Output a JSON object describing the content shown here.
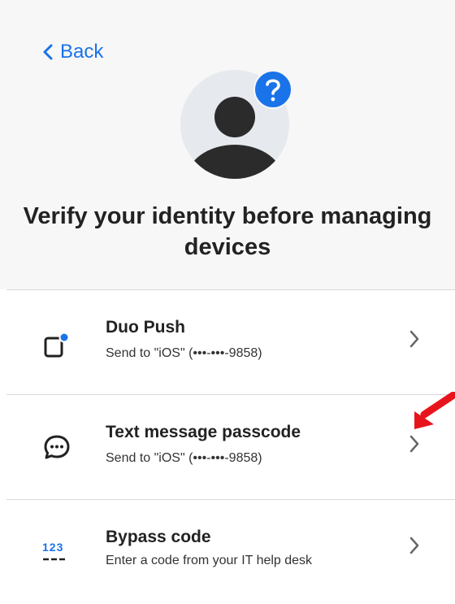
{
  "header": {
    "back_label": "Back",
    "title": "Verify your identity before managing devices"
  },
  "options": [
    {
      "name": "Duo Push",
      "description": "Send to \"iOS\" (•••-•••-9858)",
      "icon": "phone-push-icon"
    },
    {
      "name": "Text message passcode",
      "description": "Send to \"iOS\" (•••-•••-9858)",
      "icon": "chat-bubble-icon"
    },
    {
      "name": "Bypass code",
      "description": "Enter a code from your IT help desk",
      "icon": "bypass-123-icon"
    }
  ],
  "icons": {
    "bypass_digits": "123"
  },
  "colors": {
    "accent": "#1a73e8",
    "background_top": "#f7f7f7",
    "avatar_bg": "#e6e9ee",
    "avatar_fg": "#2b2b2b",
    "annotation_red": "#e8141c"
  }
}
